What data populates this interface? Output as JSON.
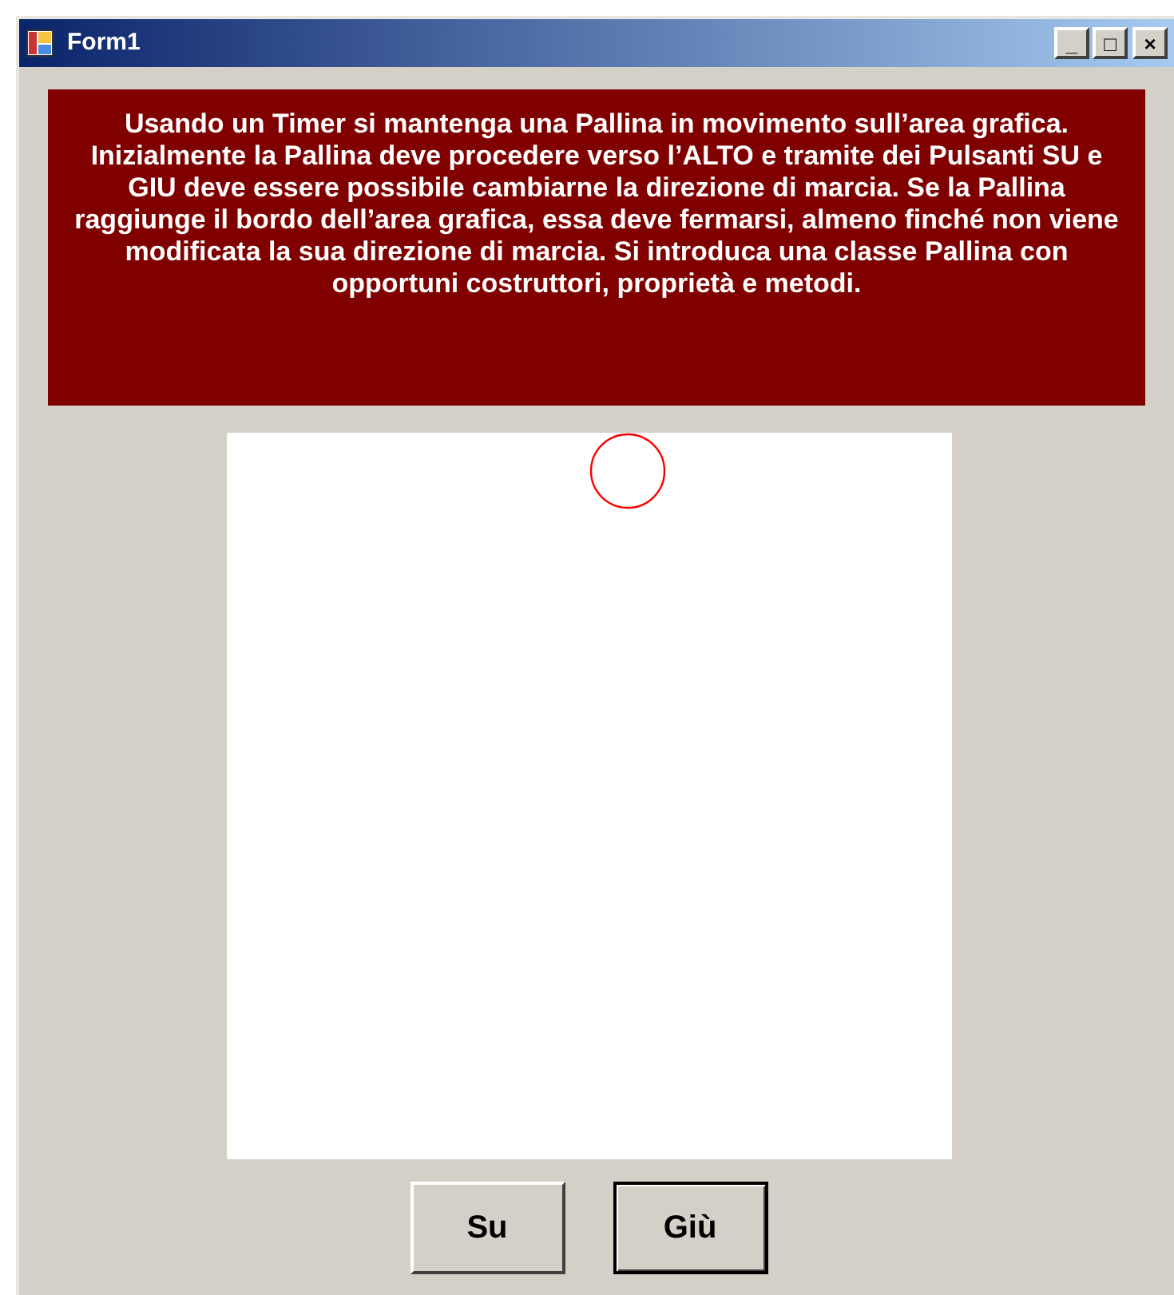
{
  "window": {
    "title": "Form1"
  },
  "title_buttons": [
    "_",
    "□",
    "×"
  ],
  "description": "Usando un Timer si mantenga una Pallina in movimento sull’area grafica. Inizialmente la Pallina deve procedere verso l’ALTO e tramite dei Pulsanti SU e GIU deve essere possibile cambiarne la direzione di marcia. Se la Pallina raggiunge il bordo dell’area grafica, essa deve fermarsi, almeno finché non viene modificata la sua direzione di marcia. Si introduca una classe Pallina con opportuni costruttori, proprietà e metodi.",
  "buttons": [
    {
      "label": "Su",
      "default": false
    },
    {
      "label": "Giù",
      "default": true
    }
  ]
}
